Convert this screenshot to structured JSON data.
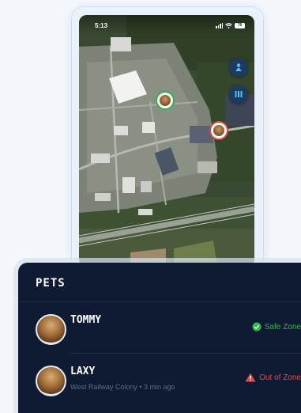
{
  "status_bar": {
    "time": "5:13",
    "battery": "76"
  },
  "map_controls": [
    {
      "name": "person-location",
      "icon": "person-pin-icon"
    },
    {
      "name": "layers",
      "icon": "bars-icon"
    }
  ],
  "map_pins": [
    {
      "pet": "TOMMY",
      "status": "safe",
      "color": "#2db34a"
    },
    {
      "pet": "LAXY",
      "status": "out",
      "color": "#e04545"
    }
  ],
  "pets_panel": {
    "title": "PETS",
    "pets": [
      {
        "name": "TOMMY",
        "location": "",
        "zone": "Safe Zone",
        "zone_color": "#2fb84e",
        "zone_icon": "check-circle-icon"
      },
      {
        "name": "LAXY",
        "location": "West Railway Colony • 3 min ago",
        "zone": "Out of Zone",
        "zone_color": "#e24a4a",
        "zone_icon": "warning-triangle-icon"
      }
    ]
  }
}
